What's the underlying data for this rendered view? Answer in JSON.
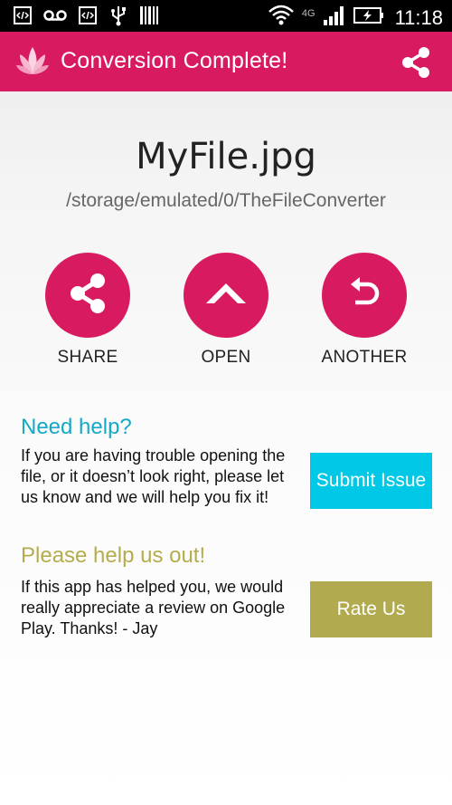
{
  "status_bar": {
    "time": "11:18",
    "network": "4G",
    "icons": [
      "debug-code-icon",
      "voicemail-icon",
      "debug-code-icon",
      "usb-icon",
      "barcode-icon",
      "wifi-icon",
      "signal-icon",
      "battery-charging-icon"
    ]
  },
  "action_bar": {
    "title": "Conversion Complete!",
    "color": "#d81b60"
  },
  "file": {
    "name": "MyFile.jpg",
    "path": "/storage/emulated/0/TheFileConverter"
  },
  "actions": [
    {
      "label": "SHARE",
      "icon": "share-icon"
    },
    {
      "label": "OPEN",
      "icon": "chevron-up-icon"
    },
    {
      "label": "ANOTHER",
      "icon": "undo-icon"
    }
  ],
  "help": {
    "title": "Need help?",
    "text": "If you are having trouble opening the file, or it doesn’t look right, please let us know and we will help you fix it!",
    "button": "Submit Issue",
    "title_color": "#14a9c7",
    "button_color": "#00c8e6"
  },
  "rate": {
    "title": "Please help us out!",
    "text": "If this app has helped you, we would really appreciate a review on Google Play. Thanks!  - Jay",
    "button": "Rate Us",
    "title_color": "#b5ac4e",
    "button_color": "#b1aa4e"
  }
}
